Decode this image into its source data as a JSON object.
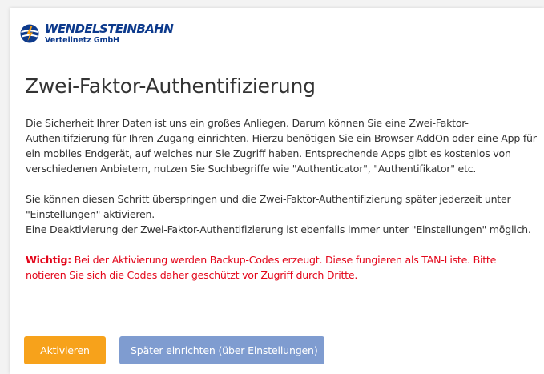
{
  "brand": {
    "name": "WENDELSTEINBAHN",
    "subtitle": "Verteilnetz GmbH",
    "logo_icon": "wendelsteinbahn-logo"
  },
  "title": "Zwei-Faktor-Authentifizierung",
  "paragraphs": {
    "intro": "Die Sicherheit Ihrer Daten ist uns ein großes Anliegen. Darum können Sie eine Zwei-Faktor-Authenitifzierung für Ihren Zugang einrichten. Hierzu benötigen Sie ein Browser-AddOn oder eine App für ein mobiles Endgerät, auf welches nur Sie Zugriff haben. Entsprechende Apps gibt es kostenlos von verschiedenen Anbietern, nutzen Sie Suchbegriffe wie \"Authenticator\", \"Authentifikator\" etc.",
    "skip": "Sie können diesen Schritt überspringen und die Zwei-Faktor-Authentifizierung später jederzeit unter \"Einstellungen\" aktivieren.",
    "deactivate": "Eine Deaktivierung der Zwei-Faktor-Authentifizierung ist ebenfalls immer unter \"Einstellungen\" möglich.",
    "important_label": "Wichtig:",
    "important_text": " Bei der Aktivierung werden Backup-Codes erzeugt. Diese fungieren als TAN-Liste. Bitte notieren Sie sich die Codes daher geschützt vor Zugriff durch Dritte."
  },
  "buttons": {
    "activate": "Aktivieren",
    "later": "Später einrichten (über Einstellungen)"
  },
  "colors": {
    "brand_blue": "#0d3a8c",
    "accent_orange": "#f7a21b",
    "secondary_blue": "#7f9cd0",
    "warning_red": "#e3061a",
    "text": "#333333"
  }
}
